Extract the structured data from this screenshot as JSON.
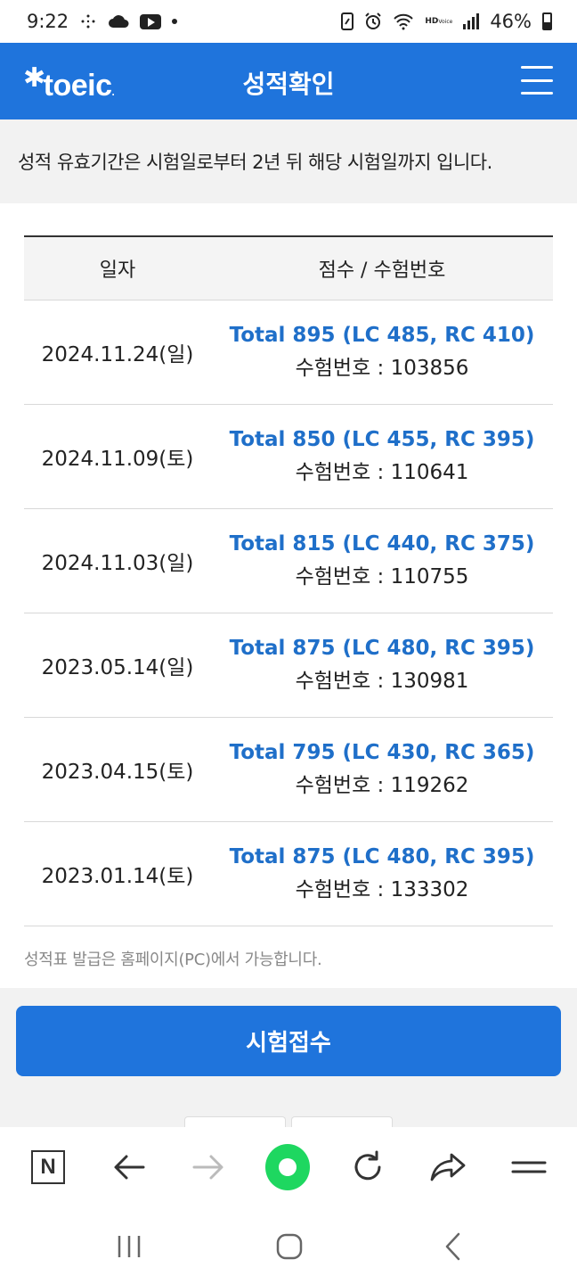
{
  "status_bar": {
    "time": "9:22",
    "battery": "46%",
    "hd_line1": "HD",
    "hd_line2": "Voice"
  },
  "header": {
    "logo": "toeic",
    "title": "성적확인",
    "brand_color": "#1f74dc"
  },
  "notice": {
    "text": "성적 유효기간은 시험일로부터 2년 뒤 해당 시험일까지 입니다."
  },
  "table": {
    "headers": {
      "date": "일자",
      "score": "점수 / 수험번호"
    },
    "rows": [
      {
        "date": "2024.11.24(일)",
        "total": "Total 895 (LC 485, RC 410)",
        "exam_no": "수험번호 : 103856"
      },
      {
        "date": "2024.11.09(토)",
        "total": "Total 850 (LC 455, RC 395)",
        "exam_no": "수험번호 : 110641"
      },
      {
        "date": "2024.11.03(일)",
        "total": "Total 815 (LC 440, RC 375)",
        "exam_no": "수험번호 : 110755"
      },
      {
        "date": "2023.05.14(일)",
        "total": "Total 875 (LC 480, RC 395)",
        "exam_no": "수험번호 : 130981"
      },
      {
        "date": "2023.04.15(토)",
        "total": "Total 795 (LC 430, RC 365)",
        "exam_no": "수험번호 : 119262"
      },
      {
        "date": "2023.01.14(토)",
        "total": "Total 875 (LC 480, RC 395)",
        "exam_no": "수험번호 : 133302"
      }
    ]
  },
  "footnote": "성적표 발급은 홈페이지(PC)에서 가능합니다.",
  "apply_button": "시험접수",
  "toolbar": {
    "n_icon_letter": "N",
    "home_color": "#1ed760"
  },
  "icons": [
    "n-icon",
    "back-icon",
    "forward-icon",
    "home-icon",
    "refresh-icon",
    "share-icon",
    "menu-icon",
    "recent-apps-icon",
    "home-nav-icon",
    "back-nav-icon"
  ]
}
